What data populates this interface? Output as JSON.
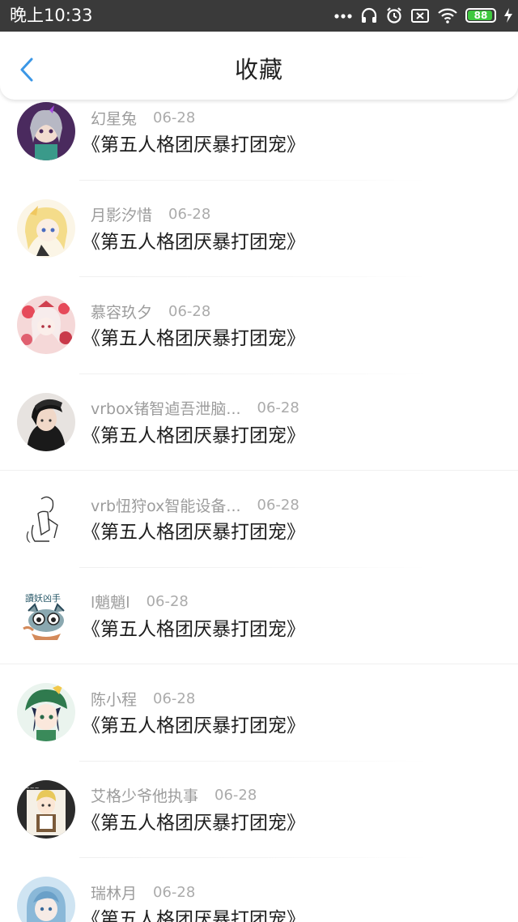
{
  "status_bar": {
    "time": "晚上10:33",
    "battery": "88",
    "icons": [
      "more-dots-icon",
      "headset-icon",
      "alarm-icon",
      "no-sim-icon",
      "wifi-icon",
      "battery-icon",
      "charging-icon"
    ]
  },
  "header": {
    "title": "收藏",
    "back_icon": "chevron-left-icon",
    "accent": "#3b97e6"
  },
  "favorites": [
    {
      "name": "幻星兔",
      "date": "06-28",
      "title": "《第五人格团厌暴打团宠》",
      "avatar": "avatar-purple"
    },
    {
      "name": "月影汐惜",
      "date": "06-28",
      "title": "《第五人格团厌暴打团宠》",
      "avatar": "avatar-blonde"
    },
    {
      "name": "慕容玖夕",
      "date": "06-28",
      "title": "《第五人格团厌暴打团宠》",
      "avatar": "avatar-red"
    },
    {
      "name": "vrbox锗智逌吾泄脑...",
      "date": "06-28",
      "title": "《第五人格团厌暴打团宠》",
      "avatar": "avatar-photo"
    },
    {
      "name": "vrb忸狩ox智能设备...",
      "date": "06-28",
      "title": "《第五人格团厌暴打团宠》",
      "avatar": "avatar-sketch"
    },
    {
      "name": "l魈魈l",
      "date": "06-28",
      "title": "《第五人格团厌暴打团宠》",
      "avatar": "avatar-cat"
    },
    {
      "name": "陈小程",
      "date": "06-28",
      "title": "《第五人格团厌暴打团宠》",
      "avatar": "avatar-green"
    },
    {
      "name": "艾格少爷他执事",
      "date": "06-28",
      "title": "《第五人格团厌暴打团宠》",
      "avatar": "avatar-dark"
    },
    {
      "name": "瑞林月",
      "date": "06-28",
      "title": "《第五人格团厌暴打团宠》",
      "avatar": "avatar-blue"
    }
  ]
}
